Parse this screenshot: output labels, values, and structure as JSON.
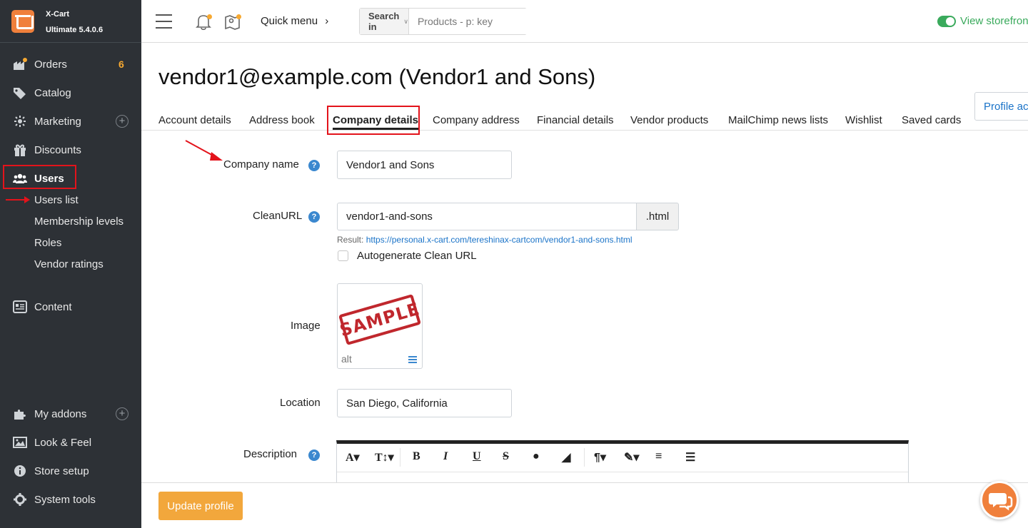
{
  "brand": {
    "name": "X-Cart",
    "edition": "Ultimate 5.4.0.6"
  },
  "sidebar": {
    "items": [
      {
        "label": "Orders",
        "badge": "6",
        "icon": "orders-icon"
      },
      {
        "label": "Catalog",
        "icon": "tag-icon"
      },
      {
        "label": "Marketing",
        "icon": "marketing-icon",
        "plus": "+"
      },
      {
        "label": "Discounts",
        "icon": "gift-icon"
      },
      {
        "label": "Users",
        "icon": "users-icon"
      },
      {
        "label": "Content",
        "icon": "content-icon"
      },
      {
        "label": "My addons",
        "icon": "puzzle-icon",
        "plus": "+"
      },
      {
        "label": "Look & Feel",
        "icon": "image-icon"
      },
      {
        "label": "Store setup",
        "icon": "info-icon"
      },
      {
        "label": "System tools",
        "icon": "gear-icon"
      }
    ],
    "users_sub": [
      "Users list",
      "Membership levels",
      "Roles",
      "Vendor ratings"
    ]
  },
  "topbar": {
    "quick_menu": "Quick menu",
    "search_in": "Search in",
    "search_placeholder": "Products - p: key",
    "view_storefront": "View storefron"
  },
  "page": {
    "title": "vendor1@example.com (Vendor1 and Sons)",
    "profile_actions": "Profile act"
  },
  "tabs": [
    "Account details",
    "Address book",
    "Company details",
    "Company address",
    "Financial details",
    "Vendor products",
    "MailChimp news lists",
    "Wishlist",
    "Saved cards"
  ],
  "active_tab": "Company details",
  "form": {
    "company_name_label": "Company name",
    "company_name_value": "Vendor1 and Sons",
    "cleanurl_label": "CleanURL",
    "cleanurl_value": "vendor1-and-sons",
    "cleanurl_suffix": ".html",
    "result_label": "Result:",
    "result_url": "https://personal.x-cart.com/tereshinax-cartcom/vendor1-and-sons.html",
    "autogenerate_label": "Autogenerate Clean URL",
    "image_label": "Image",
    "image_sample_text": "SAMPLE",
    "image_alt": "alt",
    "location_label": "Location",
    "location_value": "San Diego, California",
    "description_label": "Description",
    "help_glyph": "?"
  },
  "footer": {
    "update_button": "Update profile"
  },
  "colors": {
    "sidebar_bg": "#2d3136",
    "accent_orange": "#f2a73c",
    "link_blue": "#1a73c8",
    "highlight_red": "#e3131b",
    "storefront_green": "#3aaa5c"
  }
}
